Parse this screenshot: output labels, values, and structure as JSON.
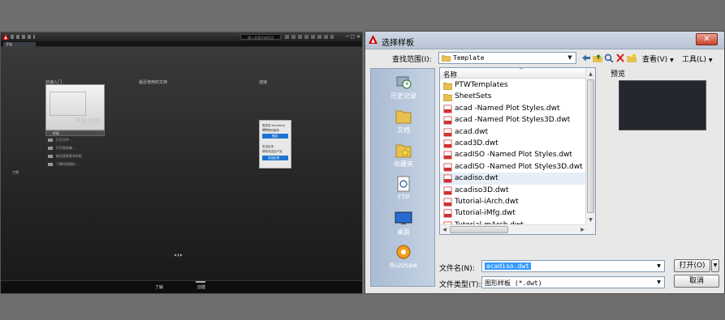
{
  "acad": {
    "tab_label": "开始",
    "search_placeholder": "键入关键字或短语",
    "columns": {
      "start": "快速入门",
      "recent": "最近使用的文档",
      "connect": "连接"
    },
    "start_card_label": "开始绘制",
    "template_selector": "样板",
    "actions": [
      "打开文件...",
      "打开图纸集...",
      "联机获取更多样板",
      "了解样例图形..."
    ],
    "side_label": "工程",
    "notice": {
      "line1": "登录到 Autodesk 360",
      "line2": "访问联机服务",
      "signin": "登录",
      "line3": "发送反馈",
      "line4": "帮助改进此产品",
      "feedback": "发送反馈"
    },
    "pager": "◀ ▮ ▶",
    "bottom_tabs": [
      "了解",
      "创建"
    ]
  },
  "dialog": {
    "title": "选择样板",
    "close_glyph": "✕",
    "look_in_label": "查找范围(I):",
    "look_in_value": "Template",
    "toolbar": {
      "views_label": "查看(V)",
      "tools_label": "工具(L)",
      "dropdown_glyph": "▼"
    },
    "places": [
      "历史记录",
      "文档",
      "收藏夹",
      "FTP",
      "桌面",
      "Buzzsaw"
    ],
    "column_name": "名称",
    "sort_glyph": "^",
    "files": [
      "PTWTemplates",
      "SheetSets",
      "acad -Named Plot Styles.dwt",
      "acad -Named Plot Styles3D.dwt",
      "acad.dwt",
      "acad3D.dwt",
      "acadISO -Named Plot Styles.dwt",
      "acadISO -Named Plot Styles3D.dwt",
      "acadiso.dwt",
      "acadiso3D.dwt",
      "Tutorial-iArch.dwt",
      "Tutorial-iMfg.dwt",
      "Tutorial-mArch.dwt"
    ],
    "selected_file": "acadiso.dwt",
    "preview_label": "预览",
    "filename_label": "文件名(N):",
    "filename_value": "acadiso.dwt",
    "filetype_label": "文件类型(T):",
    "filetype_value": "图形样板 (*.dwt)",
    "open_button": "打开(O)",
    "cancel_button": "取消",
    "colors": {
      "accent": "#3399ff",
      "close": "#c7442b",
      "places": "#aabcd3"
    }
  }
}
